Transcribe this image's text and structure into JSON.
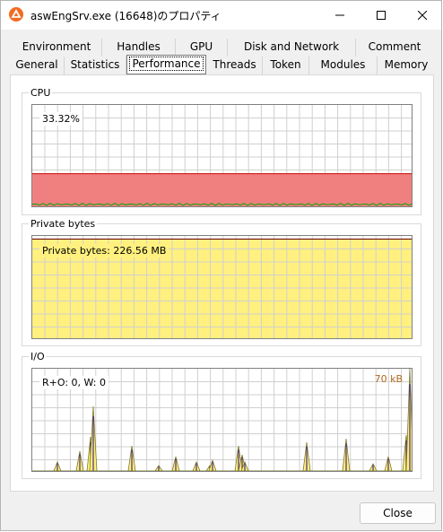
{
  "window": {
    "title": "aswEngSrv.exe (16648)のプロパティ",
    "controls": [
      "minimize-icon",
      "maximize-icon",
      "close-icon"
    ]
  },
  "tabs": {
    "row1": [
      "Environment",
      "Handles",
      "GPU",
      "Disk and Network",
      "Comment"
    ],
    "row2": [
      "General",
      "Statistics",
      "Performance",
      "Threads",
      "Token",
      "Modules",
      "Memory"
    ],
    "active": "Performance"
  },
  "cpu": {
    "label": "CPU",
    "readout": "33.32%",
    "usage_fraction": 0.3332,
    "fill_color": "#f08080",
    "line_color": "#cc0000",
    "kernel_color": "#00aa00"
  },
  "private_bytes": {
    "label": "Private bytes",
    "readout": "Private bytes: 226.56 MB",
    "fill_fraction": 0.97,
    "fill_color": "#fff07f",
    "line_color": "#660000"
  },
  "io": {
    "label": "I/O",
    "readout": "R+O: 0, W: 0",
    "scale_label": "70 kB",
    "fill_color": "#fff07f",
    "line_color": "#4b2a7a"
  },
  "buttons": {
    "close_label": "Close"
  }
}
